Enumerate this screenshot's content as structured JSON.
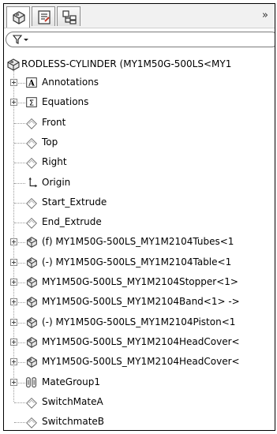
{
  "tabs": [
    {
      "name": "feature-manager",
      "icon": "assembly-tab-icon"
    },
    {
      "name": "property-manager",
      "icon": "property-tab-icon"
    },
    {
      "name": "configuration-manager",
      "icon": "configuration-tab-icon"
    }
  ],
  "chevron": "»",
  "filter": {
    "icon": "filter-icon"
  },
  "root": {
    "label": "RODLESS-CYLINDER  (MY1M50G-500LS<MY1"
  },
  "items": [
    {
      "label": "Annotations",
      "icon": "annotations-icon",
      "expandable": true
    },
    {
      "label": "Equations",
      "icon": "equations-icon",
      "expandable": true
    },
    {
      "label": "Front",
      "icon": "plane-icon",
      "expandable": false
    },
    {
      "label": "Top",
      "icon": "plane-icon",
      "expandable": false
    },
    {
      "label": "Right",
      "icon": "plane-icon",
      "expandable": false
    },
    {
      "label": "Origin",
      "icon": "origin-icon",
      "expandable": false
    },
    {
      "label": "Start_Extrude",
      "icon": "plane-icon",
      "expandable": false
    },
    {
      "label": "End_Extrude",
      "icon": "plane-icon",
      "expandable": false
    },
    {
      "label": "(f) MY1M50G-500LS_MY1M2104Tubes<1",
      "icon": "subassembly-icon",
      "expandable": true
    },
    {
      "label": "(-) MY1M50G-500LS_MY1M2104Table<1",
      "icon": "subassembly-icon",
      "expandable": true
    },
    {
      "label": "MY1M50G-500LS_MY1M2104Stopper<1>",
      "icon": "subassembly-icon",
      "expandable": true
    },
    {
      "label": "MY1M50G-500LS_MY1M2104Band<1> ->",
      "icon": "subassembly-icon",
      "expandable": true
    },
    {
      "label": "(-) MY1M50G-500LS_MY1M2104Piston<1",
      "icon": "subassembly-icon",
      "expandable": true
    },
    {
      "label": "MY1M50G-500LS_MY1M2104HeadCover<",
      "icon": "subassembly-icon",
      "expandable": true
    },
    {
      "label": "MY1M50G-500LS_MY1M2104HeadCover<",
      "icon": "subassembly-icon",
      "expandable": true
    },
    {
      "label": "MateGroup1",
      "icon": "mates-icon",
      "expandable": true
    },
    {
      "label": "SwitchMateA",
      "icon": "plane-icon",
      "expandable": false
    },
    {
      "label": "SwitchmateB",
      "icon": "plane-icon",
      "expandable": false
    }
  ]
}
